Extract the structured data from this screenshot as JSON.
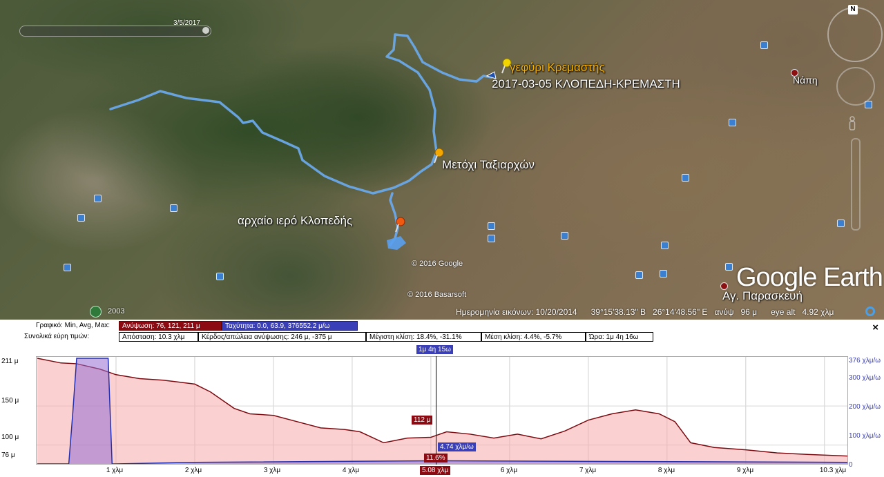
{
  "map": {
    "slider_date": "3/5/2017",
    "nav_north": "N",
    "placemarks": {
      "bridge": "γεφύρι Κρεμαστής",
      "track_name": "2017-03-05 ΚΛΟΠΕΔΗ-ΚΡΕΜΑΣΤΗ",
      "metochi": "Μετόχι Ταξιαρχών",
      "sanctuary": "αρχαίο ιερό Κλοπεδής",
      "napi": "Νάπη",
      "agia_paraskevi": "Αγ. Παρασκευή"
    },
    "copyright_google": "© 2016 Google",
    "copyright_basarsoft": "© 2016 Basarsoft",
    "logo": "Google Earth",
    "status": {
      "year": "2003",
      "imagery_date": "Ημερομηνία εικόνων: 10/20/2014",
      "lat": "39°15'38.13\" Β",
      "lon": "26°14'48.56\" Ε",
      "elev_label": "ανύψ",
      "elev_value": "96 μ",
      "eye_label": "eye alt",
      "eye_value": "4.92 χλμ"
    }
  },
  "profile": {
    "graph_label": "Γραφικό: Min, Avg, Max:",
    "elevation_cell": "Ανύψωση: 76, 121, 211 μ",
    "speed_cell": "Ταχύτητα: 0.0, 63.9, 376552.2 μ/ω",
    "totals_label": "Συνολικά εύρη τιμών:",
    "distance_cell": "Απόσταση: 10.3 χλμ",
    "gain_cell": "Κέρδος/απώλεια ανύψωσης: 246 μ, -375 μ",
    "max_slope_cell": "Μέγιστη κλίση: 18.4%, -31.1%",
    "avg_slope_cell": "Μέση κλίση: 4.4%, -5.7%",
    "time_cell": "Ώρα: 1μ 4η 16ω",
    "close": "×",
    "cursor": {
      "time": "1μ 4η 15ω",
      "elevation": "112 μ",
      "speed": "4.74 χλμ/ω",
      "slope": "11.6%",
      "distance": "5.08 χλμ"
    },
    "y_left_labels": [
      "211 μ",
      "150 μ",
      "100 μ",
      "76 μ"
    ],
    "y_right_labels": [
      "376 χλμ/ω",
      "300 χλμ/ω",
      "200 χλμ/ω",
      "100 χλμ/ω",
      "0"
    ],
    "x_labels": [
      "1 χλμ",
      "2 χλμ",
      "3 χλμ",
      "4 χλμ",
      "6 χλμ",
      "7 χλμ",
      "8 χλμ",
      "9 χλμ",
      "10.3 χλμ"
    ]
  },
  "chart_data": {
    "type": "area",
    "x_unit": "χλμ",
    "y_unit": "μ",
    "ylim": [
      76,
      211
    ],
    "xlim": [
      0,
      10.3
    ],
    "grid": true,
    "series": [
      {
        "name": "Ανύψωση",
        "x": [
          0,
          0.3,
          0.5,
          0.8,
          1.0,
          1.3,
          1.6,
          2.0,
          2.2,
          2.5,
          2.7,
          3.0,
          3.3,
          3.6,
          3.9,
          4.1,
          4.4,
          4.7,
          5.0,
          5.2,
          5.5,
          5.8,
          6.1,
          6.4,
          6.7,
          7.0,
          7.3,
          7.6,
          7.9,
          8.1,
          8.3,
          8.6,
          9.0,
          9.4,
          9.8,
          10.3
        ],
        "y": [
          211,
          205,
          204,
          197,
          190,
          185,
          183,
          178,
          168,
          147,
          140,
          138,
          130,
          122,
          120,
          117,
          103,
          109,
          110,
          117,
          114,
          109,
          114,
          108,
          118,
          132,
          140,
          145,
          140,
          130,
          103,
          97,
          94,
          90,
          88,
          86
        ]
      },
      {
        "name": "Ταχύτητα",
        "x": [
          0,
          0.4,
          0.45,
          0.5,
          0.9,
          0.95,
          1.0,
          2.0,
          5.08,
          10.3
        ],
        "y": [
          76,
          76,
          140,
          211,
          211,
          76,
          76,
          78,
          80,
          78
        ]
      }
    ]
  }
}
